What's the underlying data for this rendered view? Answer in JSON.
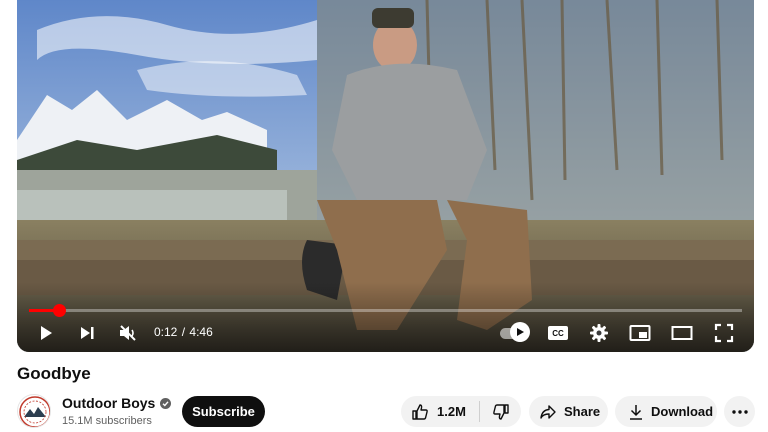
{
  "player": {
    "current_time": "0:12",
    "separator": "/",
    "duration": "4:46",
    "progress_fraction": 0.042,
    "autoplay_on": true,
    "cc_label": "CC",
    "accent_color": "#ff0000"
  },
  "video": {
    "title": "Goodbye"
  },
  "channel": {
    "name": "Outdoor Boys",
    "subscribers": "15.1M subscribers",
    "verified": true,
    "avatar_icon": "outdoor-boys-logo-icon"
  },
  "actions": {
    "subscribe_label": "Subscribe",
    "like_count": "1.2M",
    "share_label": "Share",
    "download_label": "Download",
    "more_icon": "more-horizontal-icon"
  }
}
